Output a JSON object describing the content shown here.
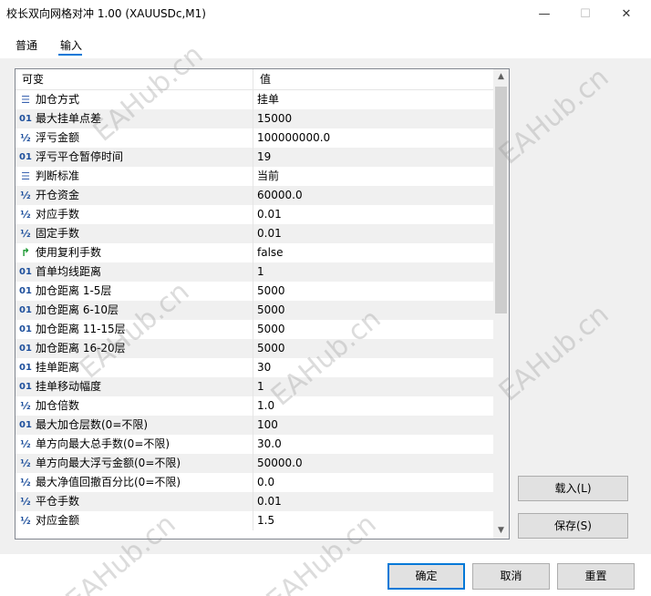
{
  "window": {
    "title": "校长双向网格对冲 1.00 (XAUUSDc,M1)",
    "minimize_glyph": "—",
    "maximize_glyph": "☐",
    "close_glyph": "✕"
  },
  "tabs": [
    {
      "label": "普通",
      "active": false
    },
    {
      "label": "输入",
      "active": true
    }
  ],
  "table": {
    "columns": [
      "可变",
      "值"
    ],
    "rows": [
      {
        "icon": "enum-icon",
        "glyph": "☰",
        "name": "加仓方式",
        "value": "挂单"
      },
      {
        "icon": "int-icon",
        "glyph": "01",
        "name": "最大挂单点差",
        "value": "15000"
      },
      {
        "icon": "double-icon",
        "glyph": "½",
        "name": "浮亏金额",
        "value": "100000000.0"
      },
      {
        "icon": "int-icon",
        "glyph": "01",
        "name": "浮亏平仓暂停时间",
        "value": "19"
      },
      {
        "icon": "enum-icon",
        "glyph": "☰",
        "name": "判断标准",
        "value": "当前"
      },
      {
        "icon": "double-icon",
        "glyph": "½",
        "name": "开仓资金",
        "value": "60000.0"
      },
      {
        "icon": "double-icon",
        "glyph": "½",
        "name": "对应手数",
        "value": "0.01"
      },
      {
        "icon": "double-icon",
        "glyph": "½",
        "name": "固定手数",
        "value": "0.01"
      },
      {
        "icon": "bool-icon",
        "glyph": "↱",
        "name": "使用复利手数",
        "value": "false"
      },
      {
        "icon": "int-icon",
        "glyph": "01",
        "name": "首单均线距离",
        "value": "1"
      },
      {
        "icon": "int-icon",
        "glyph": "01",
        "name": "加仓距离 1-5层",
        "value": "5000"
      },
      {
        "icon": "int-icon",
        "glyph": "01",
        "name": "加仓距离 6-10层",
        "value": "5000"
      },
      {
        "icon": "int-icon",
        "glyph": "01",
        "name": "加仓距离 11-15层",
        "value": "5000"
      },
      {
        "icon": "int-icon",
        "glyph": "01",
        "name": "加仓距离 16-20层",
        "value": "5000"
      },
      {
        "icon": "int-icon",
        "glyph": "01",
        "name": "挂单距离",
        "value": "30"
      },
      {
        "icon": "int-icon",
        "glyph": "01",
        "name": "挂单移动幅度",
        "value": "1"
      },
      {
        "icon": "double-icon",
        "glyph": "½",
        "name": "加仓倍数",
        "value": "1.0"
      },
      {
        "icon": "int-icon",
        "glyph": "01",
        "name": "最大加仓层数(0=不限)",
        "value": "100"
      },
      {
        "icon": "double-icon",
        "glyph": "½",
        "name": "单方向最大总手数(0=不限)",
        "value": "30.0"
      },
      {
        "icon": "double-icon",
        "glyph": "½",
        "name": "单方向最大浮亏金额(0=不限)",
        "value": "50000.0"
      },
      {
        "icon": "double-icon",
        "glyph": "½",
        "name": "最大净值回撤百分比(0=不限)",
        "value": "0.0"
      },
      {
        "icon": "double-icon",
        "glyph": "½",
        "name": "平仓手数",
        "value": "0.01"
      },
      {
        "icon": "double-icon",
        "glyph": "½",
        "name": "对应金额",
        "value": "1.5"
      }
    ]
  },
  "buttons": {
    "load": "载入(L)",
    "save": "保存(S)",
    "ok": "确定",
    "cancel": "取消",
    "reset": "重置"
  },
  "watermark": "EAHub.cn"
}
